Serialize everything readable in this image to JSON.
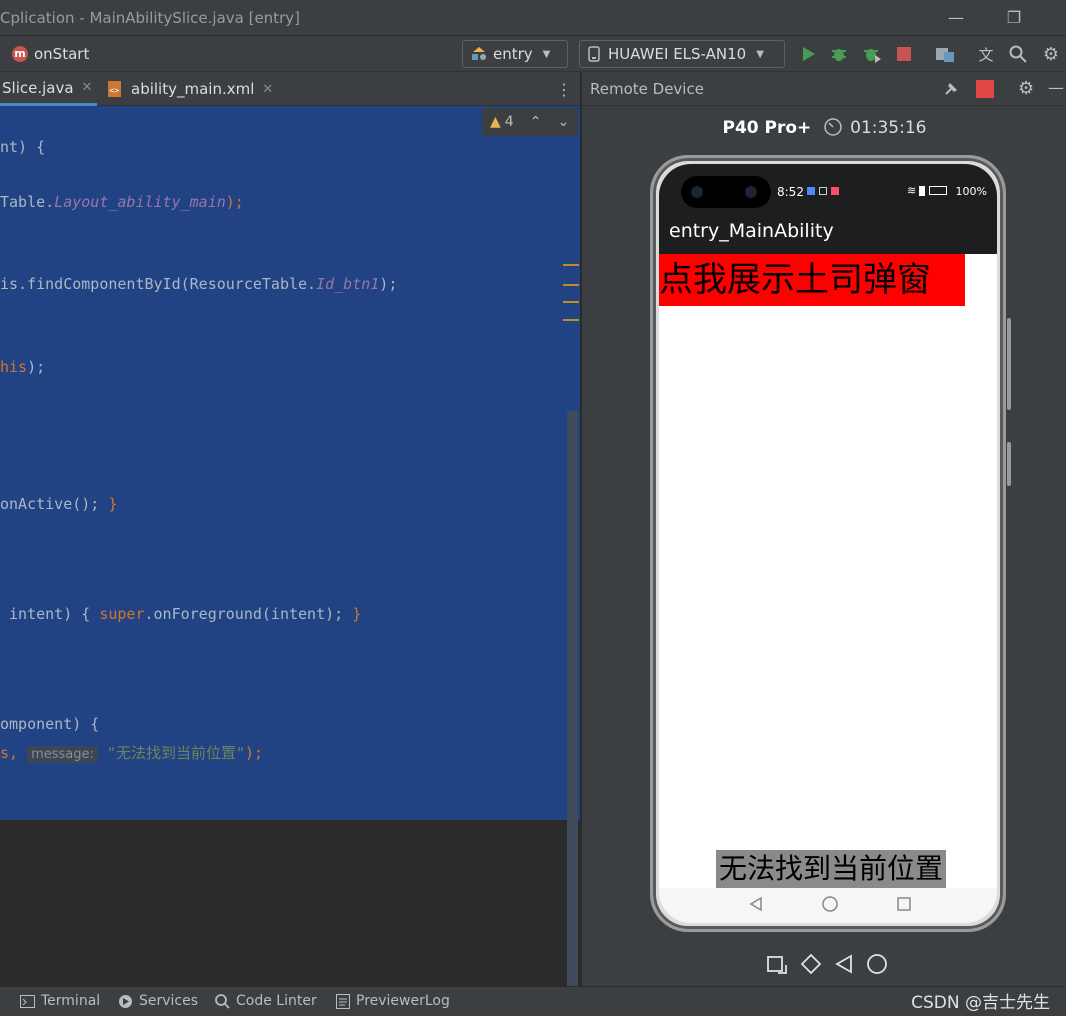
{
  "window": {
    "title": "Cplication - MainAbilitySlice.java [entry]"
  },
  "toolbar": {
    "breadcrumb_icon_letter": "m",
    "breadcrumb": "onStart",
    "module_combo": "entry",
    "device_combo": "HUAWEI ELS-AN10"
  },
  "tabs": [
    {
      "label": "Slice.java",
      "active": true
    },
    {
      "label": "ability_main.xml",
      "active": false
    }
  ],
  "editor": {
    "warnings_count": "4",
    "lines": {
      "l1": "nt) {",
      "l2a": "Table.",
      "l2b": "Layout_ability_main",
      "l2c": ");",
      "l3a": "is.findComponentById(ResourceTable.",
      "l3b": "Id_btn1",
      "l3c": ");",
      "l4a": "his",
      "l4b": ");",
      "l5a": "onActive(); ",
      "l5b": "}",
      "l6a": " intent) { ",
      "l6b": "super",
      "l6c": ".onForeground(intent); ",
      "l6d": "}",
      "l7": "omponent) {",
      "l8a": "s, ",
      "l8hint": "message:",
      "l8str": "\"无法找到当前位置\"",
      "l8c": ");"
    }
  },
  "remote_device": {
    "panel_title": "Remote Device",
    "model": "P40 Pro+",
    "timer": "01:35:16",
    "phone": {
      "status_time": "8:52",
      "battery": "100%",
      "app_title": "entry_MainAbility",
      "button_text": "点我展示土司弹窗",
      "toast_text": "无法找到当前位置"
    }
  },
  "bottom_tools": [
    {
      "label": "Terminal",
      "icon": "terminal-icon"
    },
    {
      "label": "Services",
      "icon": "services-icon"
    },
    {
      "label": "Code Linter",
      "icon": "code-linter-icon"
    },
    {
      "label": "PreviewerLog",
      "icon": "previewer-log-icon"
    }
  ],
  "watermark": "CSDN @吉士先生",
  "colors": {
    "selection": "#214283",
    "keyword": "#cc7832",
    "field": "#9876aa",
    "string": "#6a8759",
    "run_green": "#499c54",
    "stop_red": "#c75450",
    "phone_button_red": "#ff0000"
  }
}
